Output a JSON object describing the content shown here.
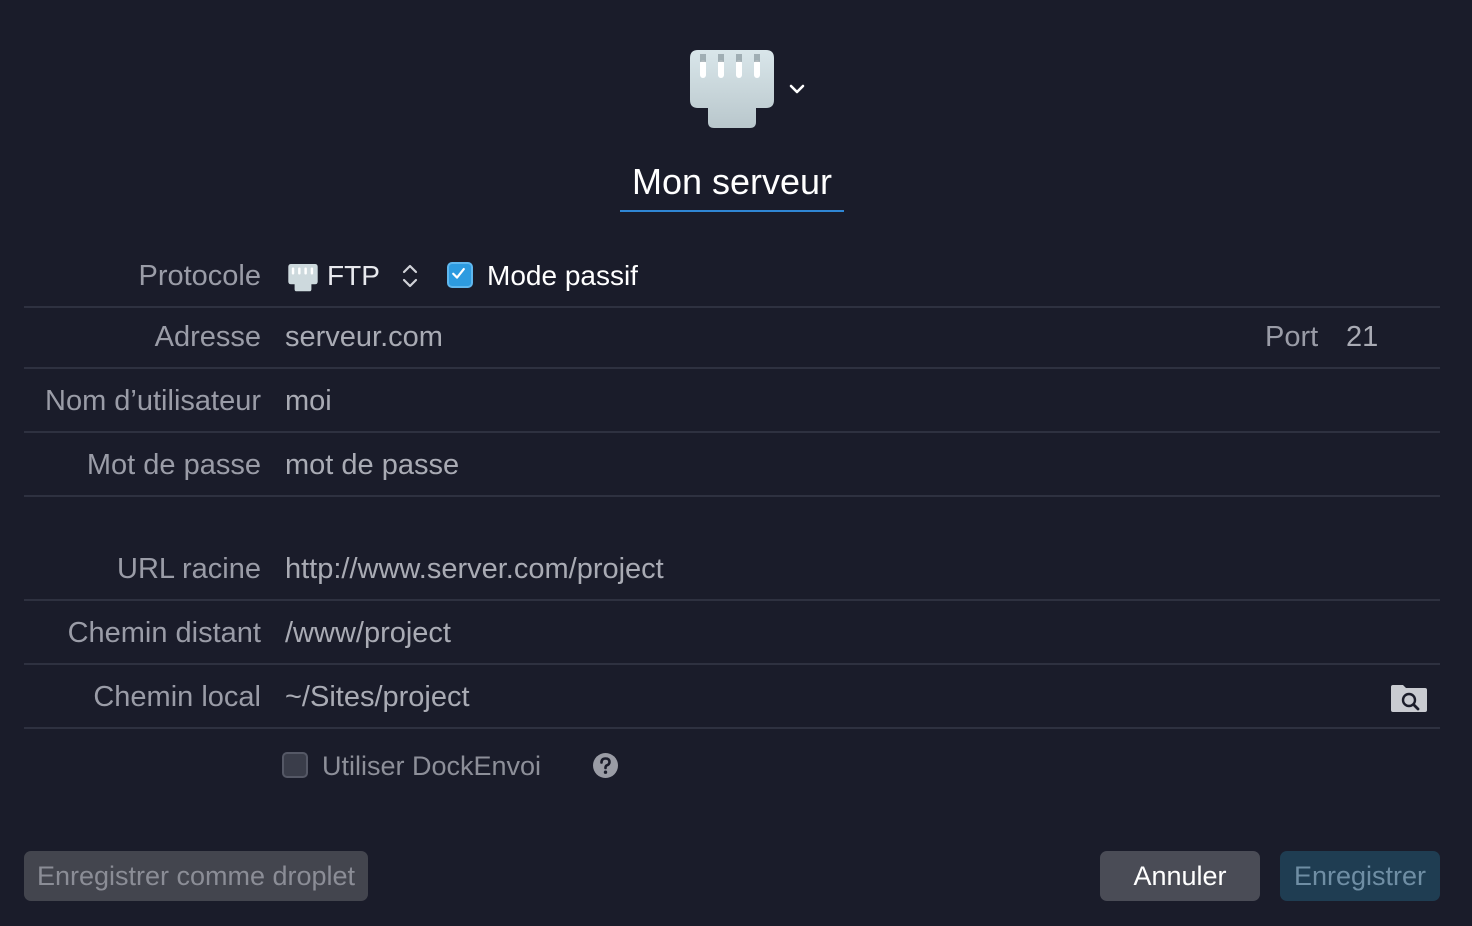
{
  "header": {
    "server_name": "Mon serveur"
  },
  "form": {
    "protocol": {
      "label": "Protocole",
      "value": "FTP",
      "passive_checked": true,
      "passive_label": "Mode passif"
    },
    "address": {
      "label": "Adresse",
      "value": "serveur.com",
      "port_label": "Port",
      "port_value": "21"
    },
    "username": {
      "label": "Nom d’utilisateur",
      "value": "moi"
    },
    "password": {
      "label": "Mot de passe",
      "value": "mot de passe"
    },
    "root_url": {
      "label": "URL racine",
      "value": "http://www.server.com/project"
    },
    "remote_path": {
      "label": "Chemin distant",
      "value": "/www/project"
    },
    "local_path": {
      "label": "Chemin local",
      "value": "~/Sites/project"
    },
    "dockenvoi": {
      "label": "Utiliser DockEnvoi",
      "checked": false
    }
  },
  "buttons": {
    "droplet": "Enregistrer comme droplet",
    "cancel": "Annuler",
    "save": "Enregistrer"
  },
  "icons": {
    "server": "ethernet-port-icon",
    "chevron": "chevron-down-icon",
    "stepper": "up-down-stepper-icon",
    "checkbox": "checkmark-icon",
    "folder": "folder-search-icon",
    "help": "question-mark-icon"
  },
  "colors": {
    "background": "#1a1c2a",
    "accent": "#2d9be0",
    "underline": "#2f86d4"
  }
}
